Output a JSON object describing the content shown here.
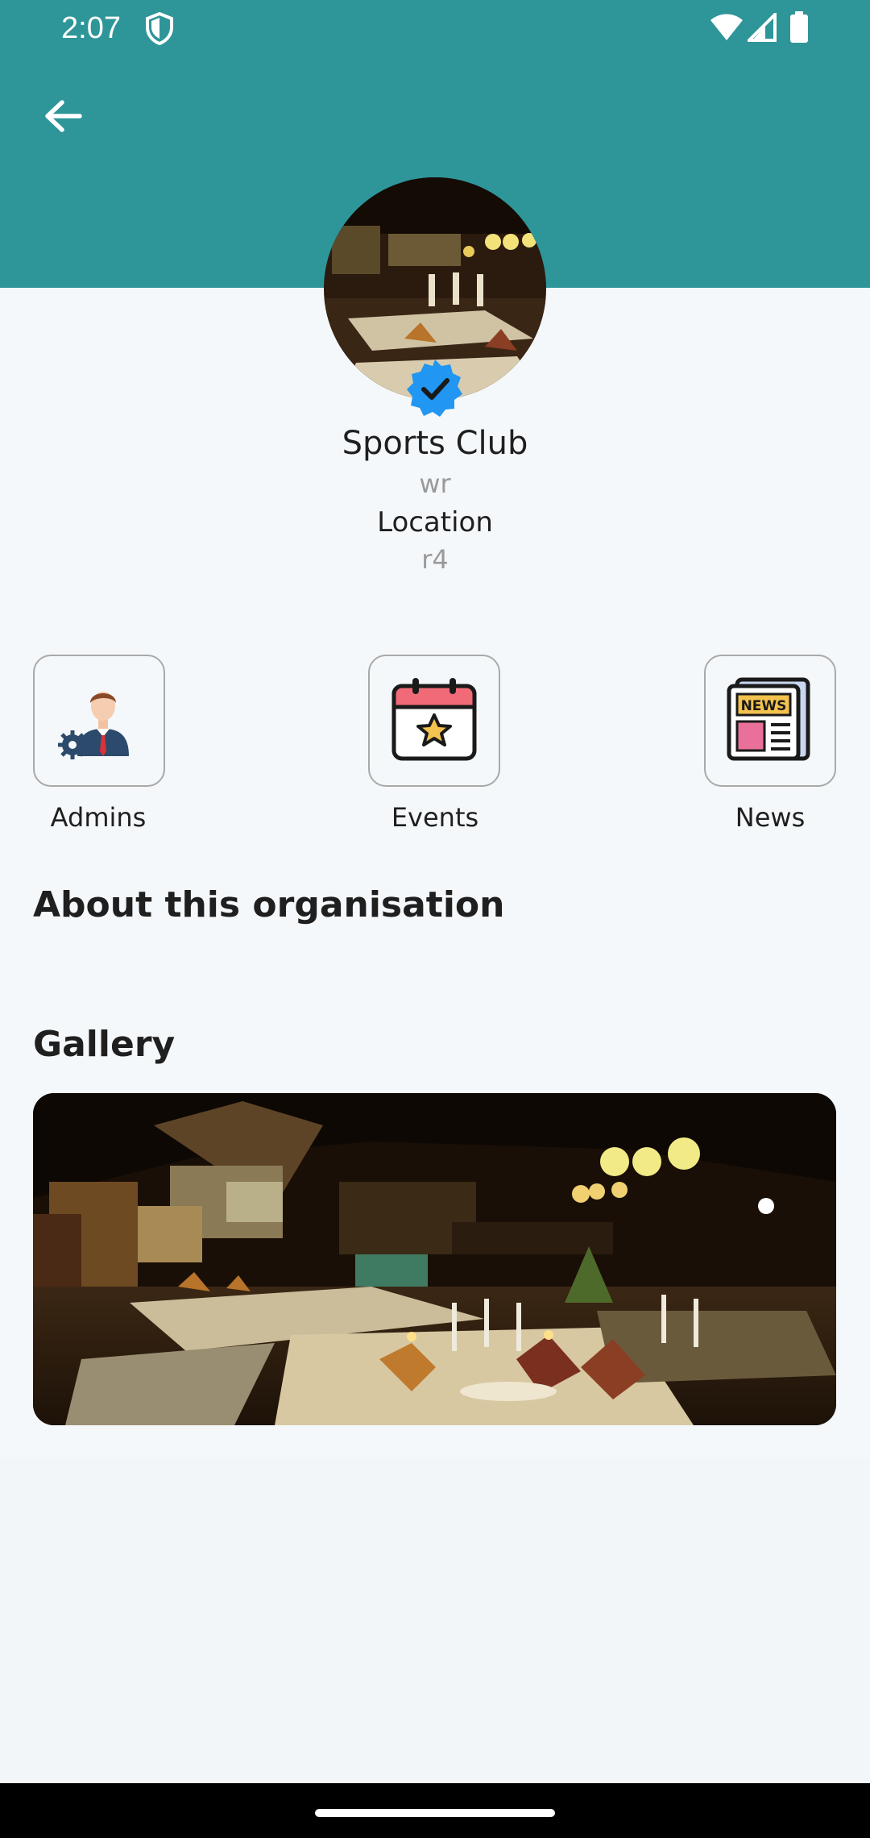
{
  "status_bar": {
    "time": "2:07",
    "icons": [
      "shield-icon",
      "wifi-icon",
      "signal-icon",
      "battery-icon"
    ]
  },
  "header": {
    "back_icon": "arrow-left-icon",
    "color": "#2e9599"
  },
  "organisation": {
    "name": "Sports Club",
    "subtitle": "wr",
    "location_label": "Location",
    "location_value": "r4",
    "verified_icon": "verified-badge-icon",
    "verified_color": "#2196f3"
  },
  "quick_links": [
    {
      "label": "Admins",
      "icon": "admin-user-icon"
    },
    {
      "label": "Events",
      "icon": "calendar-star-icon"
    },
    {
      "label": "News",
      "icon": "newspaper-icon"
    }
  ],
  "about": {
    "title": "About this organisation"
  },
  "gallery": {
    "title": "Gallery"
  }
}
